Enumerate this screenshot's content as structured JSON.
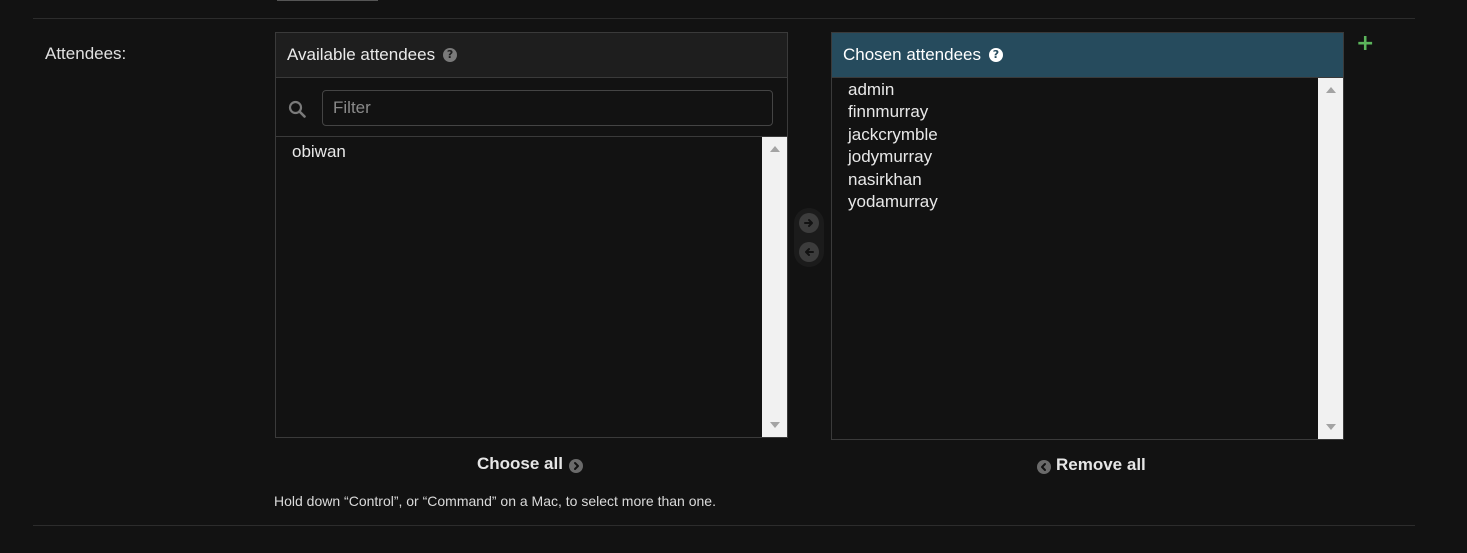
{
  "field": {
    "label": "Attendees:"
  },
  "available": {
    "title": "Available attendees",
    "help_icon": "question-circle-icon",
    "filter_placeholder": "Filter",
    "filter_value": "",
    "items": [
      "obiwan"
    ]
  },
  "chosen": {
    "title": "Chosen attendees",
    "help_icon": "question-circle-icon",
    "items": [
      "admin",
      "finnmurray",
      "jackcrymble",
      "jodymurray",
      "nasirkhan",
      "yodamurray"
    ]
  },
  "actions": {
    "choose_all": "Choose all",
    "remove_all": "Remove all",
    "add_icon": "arrow-right-circle-icon",
    "remove_icon": "arrow-left-circle-icon",
    "add_related_icon": "plus-icon"
  },
  "help_text": "Hold down “Control”, or “Command” on a Mac, to select more than one.",
  "colors": {
    "background": "#121212",
    "chosen_header": "#264b5d",
    "add_related": "#5cb55c"
  }
}
